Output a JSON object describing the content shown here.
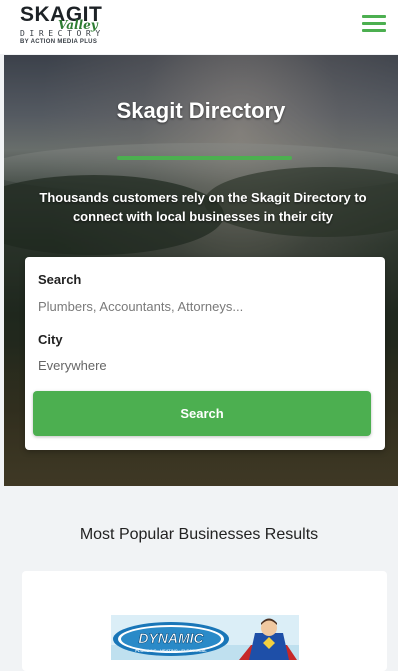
{
  "header": {
    "logo": {
      "main": "SKAGIT",
      "script": "Valley",
      "directory": "DIRECTORY",
      "byline": "BY ACTION MEDIA PLUS"
    },
    "menu_icon": "hamburger-menu-icon"
  },
  "hero": {
    "title": "Skagit Directory",
    "subtitle": "Thousands customers rely on the Skagit Directory to connect with local businesses in their city"
  },
  "search": {
    "search_label": "Search",
    "search_placeholder": "Plumbers, Accountants, Attorneys...",
    "city_label": "City",
    "city_value": "Everywhere",
    "button_label": "Search"
  },
  "popular": {
    "title": "Most Popular Businesses Results",
    "first_business_logo_text": "DYNAMIC",
    "first_business_logo_tagline": "PLUMBING · HEATING · ELECTRICAL"
  },
  "colors": {
    "accent": "#4caf50",
    "background": "#f1f3f5",
    "card": "#ffffff"
  }
}
